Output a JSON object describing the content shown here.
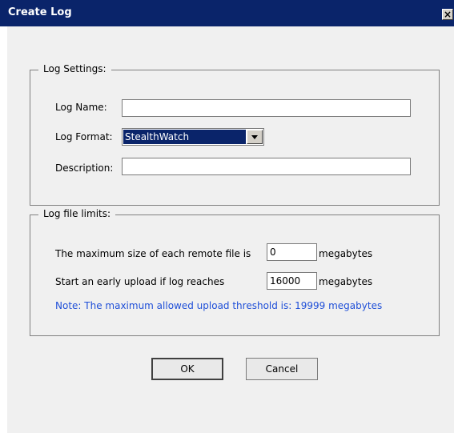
{
  "window": {
    "title": "Create Log",
    "close_glyph": "×"
  },
  "log_settings": {
    "legend": "Log Settings:",
    "name_label": "Log Name:",
    "name_value": "",
    "format_label": "Log Format:",
    "format_value": "StealthWatch",
    "description_label": "Description:",
    "description_value": ""
  },
  "log_limits": {
    "legend": "Log file limits:",
    "max_size_label": "The maximum size of each remote file is",
    "max_size_value": "0",
    "max_size_unit": "megabytes",
    "early_upload_label": "Start an early upload if log reaches",
    "early_upload_value": "16000",
    "early_upload_unit": "megabytes",
    "note": "Note: The maximum allowed upload threshold is: 19999 megabytes"
  },
  "buttons": {
    "ok": "OK",
    "cancel": "Cancel"
  }
}
